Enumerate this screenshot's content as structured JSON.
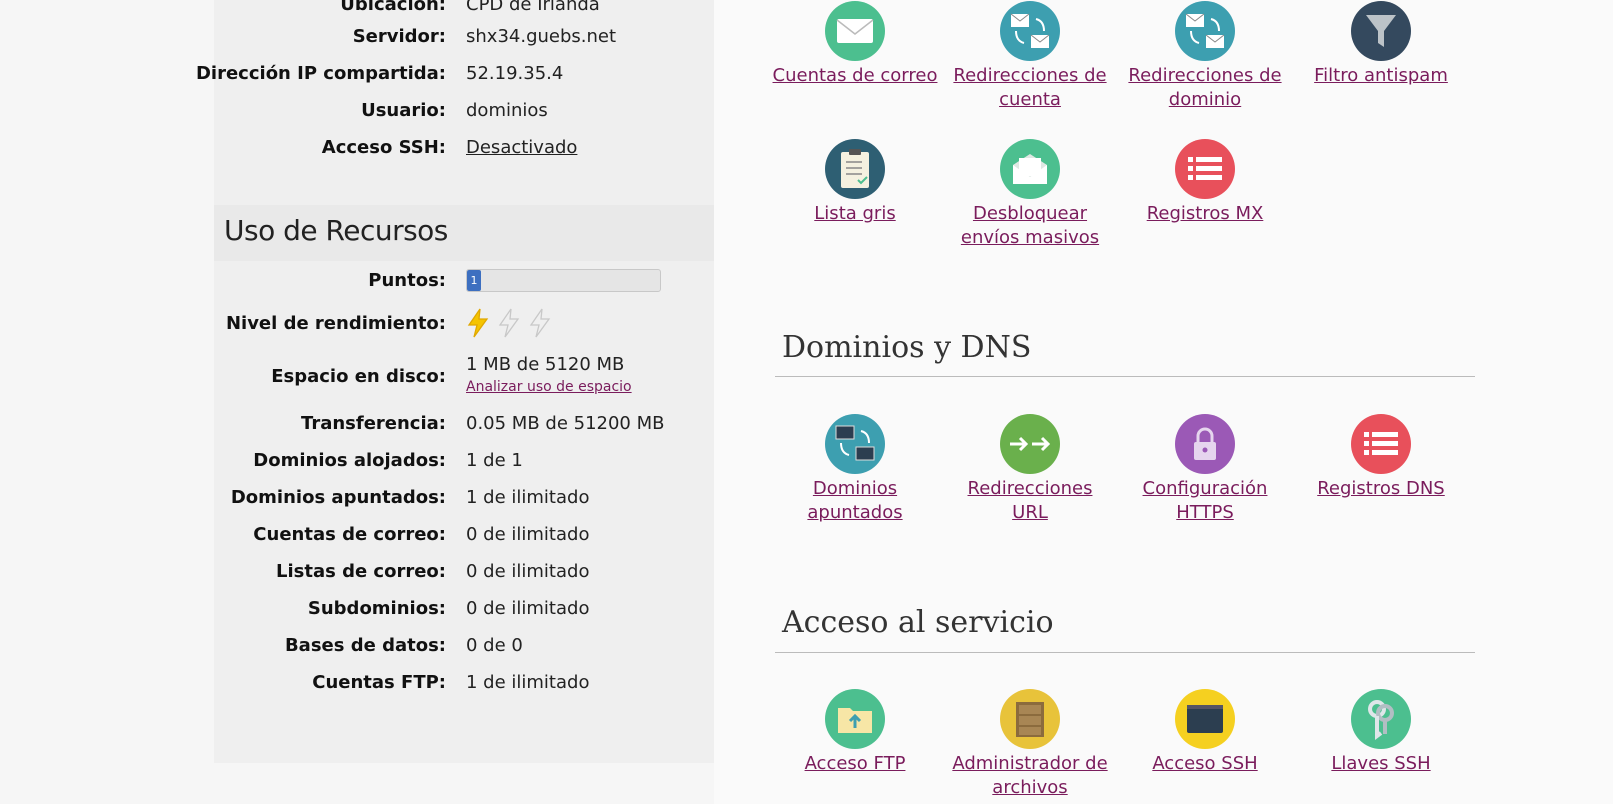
{
  "info": {
    "rows": [
      {
        "label": "Ubicación:",
        "value": "CPD de Irlanda"
      },
      {
        "label": "Servidor:",
        "value": "shx34.guebs.net"
      },
      {
        "label": "Dirección IP compartida:",
        "value": "52.19.35.4"
      },
      {
        "label": "Usuario:",
        "value": "dominios"
      },
      {
        "label": "Acceso SSH:",
        "value": "Desactivado"
      }
    ]
  },
  "resources": {
    "title": "Uso de Recursos",
    "points_label": "Puntos:",
    "points_value": "1",
    "points_fraction": 0.06,
    "performance_label": "Nivel de rendimiento:",
    "performance_level": 1,
    "performance_max": 3,
    "disk_label": "Espacio en disco:",
    "disk_value": "1 MB de 5120 MB",
    "disk_link": "Analizar uso de espacio",
    "rows": [
      {
        "label": "Transferencia:",
        "value": "0.05 MB de 51200 MB"
      },
      {
        "label": "Dominios alojados:",
        "value": "1 de 1"
      },
      {
        "label": "Dominios apuntados:",
        "value": "1 de ilimitado"
      },
      {
        "label": "Cuentas de correo:",
        "value": "0 de ilimitado"
      },
      {
        "label": "Listas de correo:",
        "value": "0 de ilimitado"
      },
      {
        "label": "Subdominios:",
        "value": "0 de ilimitado"
      },
      {
        "label": "Bases de datos:",
        "value": "0 de 0"
      },
      {
        "label": "Cuentas FTP:",
        "value": "1 de ilimitado"
      }
    ]
  },
  "mail": {
    "tiles": [
      {
        "line1": "Cuentas de correo",
        "line2": "",
        "icon": "envelope-icon",
        "color": "#4cbf8f"
      },
      {
        "line1": "Redirecciones de",
        "line2": "cuenta",
        "icon": "mail-redirect-icon",
        "color": "#3d9fb0"
      },
      {
        "line1": "Redirecciones de",
        "line2": "dominio",
        "icon": "mail-redirect-icon",
        "color": "#3d9fb0"
      },
      {
        "line1": "Filtro antispam",
        "line2": "",
        "icon": "funnel-icon",
        "color": "#34495e"
      },
      {
        "line1": "Lista gris",
        "line2": "",
        "icon": "clipboard-icon",
        "color": "#2e5f73"
      },
      {
        "line1": "Desbloquear",
        "line2": "envíos masivos",
        "icon": "open-mail-icon",
        "color": "#4cbf8f"
      },
      {
        "line1": "Registros MX",
        "line2": "",
        "icon": "list-icon",
        "color": "#e8505b"
      }
    ]
  },
  "dns": {
    "title": "Dominios y DNS",
    "tiles": [
      {
        "line1": "Dominios",
        "line2": "apuntados",
        "icon": "monitors-icon",
        "color": "#3d9fb0"
      },
      {
        "line1": "Redirecciones",
        "line2": "URL",
        "icon": "arrows-icon",
        "color": "#6ab04c"
      },
      {
        "line1": "Configuración",
        "line2": "HTTPS",
        "icon": "padlock-icon",
        "color": "#9b59b6"
      },
      {
        "line1": "Registros DNS",
        "line2": "",
        "icon": "list-icon",
        "color": "#e8505b"
      }
    ]
  },
  "access": {
    "title": "Acceso al servicio",
    "tiles": [
      {
        "line1": "Acceso FTP",
        "line2": "",
        "icon": "folder-upload-icon",
        "color": "#4cbf8f"
      },
      {
        "line1": "Administrador de",
        "line2": "archivos",
        "icon": "cabinet-icon",
        "color": "#e8c33a"
      },
      {
        "line1": "Acceso SSH",
        "line2": "",
        "icon": "terminal-icon",
        "color": "#f5d020"
      },
      {
        "line1": "Llaves SSH",
        "line2": "",
        "icon": "keys-icon",
        "color": "#4cbf8f"
      }
    ]
  }
}
